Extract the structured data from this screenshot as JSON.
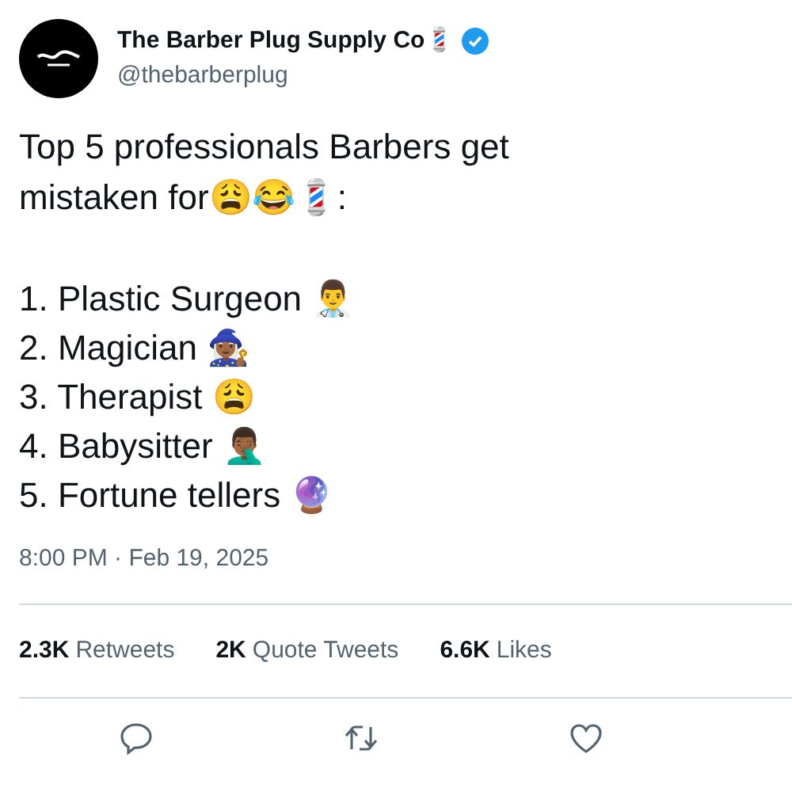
{
  "author": {
    "name": "The Barber Plug Supply Co💈",
    "verified": true,
    "handle": "@thebarberplug"
  },
  "tweet": {
    "intro": "Top 5 professionals Barbers get mistaken for😩😂💈:",
    "list": [
      "1. Plastic Surgeon 👨‍⚕️",
      "2. Magician 🧙🏾‍♀️",
      "3. Therapist 😩",
      "4. Babysitter 🤦🏾‍♂️",
      "5. Fortune tellers 🔮"
    ],
    "timestamp": "8:00 PM · Feb 19, 2025"
  },
  "stats": [
    {
      "count": "2.3K",
      "label": "Retweets"
    },
    {
      "count": "2K",
      "label": "Quote Tweets"
    },
    {
      "count": "6.6K",
      "label": "Likes"
    }
  ],
  "actions": [
    {
      "kind": "reply"
    },
    {
      "kind": "retweet"
    },
    {
      "kind": "like"
    }
  ]
}
